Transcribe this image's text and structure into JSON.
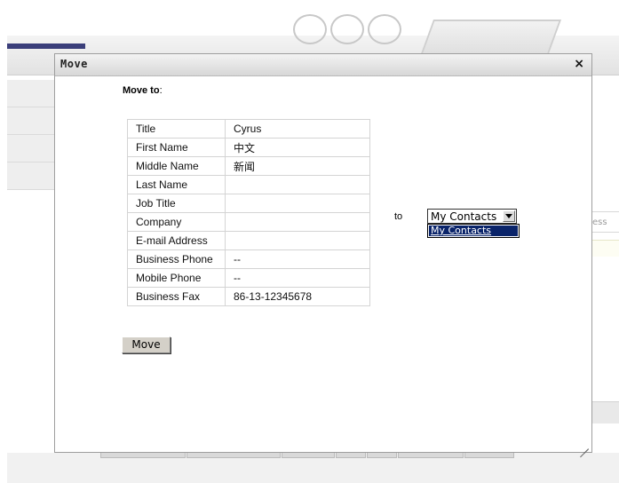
{
  "dialog": {
    "title": "Move",
    "close_glyph": "×",
    "move_to_label": "Move to",
    "move_to_colon": ":",
    "to_label": "to",
    "move_button_label": "Move"
  },
  "contact": {
    "rows": [
      {
        "label": "Title",
        "value": "Cyrus"
      },
      {
        "label": "First Name",
        "value": "中文"
      },
      {
        "label": "Middle Name",
        "value": "新闻"
      },
      {
        "label": "Last Name",
        "value": ""
      },
      {
        "label": "Job Title",
        "value": ""
      },
      {
        "label": "Company",
        "value": ""
      },
      {
        "label": "E-mail Address",
        "value": ""
      },
      {
        "label": "Business Phone",
        "value": "--"
      },
      {
        "label": "Mobile Phone",
        "value": "--"
      },
      {
        "label": "Business Fax",
        "value": "86-13-12345678"
      }
    ]
  },
  "folder_select": {
    "selected": "My Contacts",
    "options": [
      "My Contacts"
    ]
  },
  "background": {
    "field_text": "ess"
  },
  "icons": {
    "close": "close-icon",
    "dropdown_arrow": "chevron-down-icon",
    "resize": "resize-grip-icon"
  }
}
